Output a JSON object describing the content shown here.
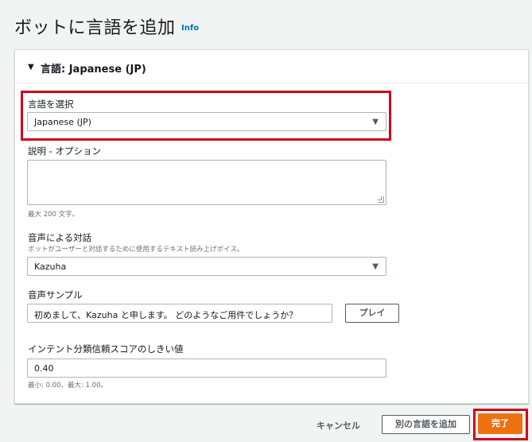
{
  "page": {
    "title": "ボットに言語を追加",
    "info": "Info"
  },
  "section": {
    "header": "言語: Japanese (JP)",
    "caret": "▼"
  },
  "language": {
    "label": "言語を選択",
    "value": "Japanese (JP)"
  },
  "description": {
    "label": "説明 - オプション",
    "value": "",
    "hint": "最大 200 文字。"
  },
  "voice": {
    "label": "音声による対話",
    "hint": "ボットがユーザーと対話するために使用するテキスト読み上げボイス。",
    "value": "Kazuha"
  },
  "sample": {
    "label": "音声サンプル",
    "value": "初めまして、Kazuha と申します。 どのようなご用件でしょうか？",
    "play_label": "プレイ"
  },
  "threshold": {
    "label": "インテント分類信頼スコアのしきい値",
    "value": "0.40",
    "hint": "最小: 0.00、最大: 1.00。"
  },
  "footer": {
    "cancel": "キャンセル",
    "add_another": "別の言語を追加",
    "done": "完了"
  },
  "icons": {
    "dropdown": "▼"
  },
  "colors": {
    "primary": "#ec7211",
    "highlight": "#d0021b",
    "link": "#0073bb"
  }
}
